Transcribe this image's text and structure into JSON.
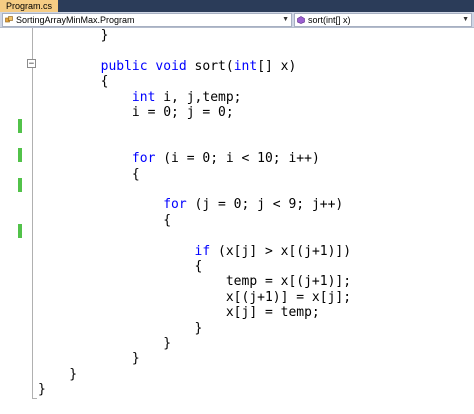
{
  "tab": {
    "title": "Program.cs"
  },
  "navbar": {
    "class_combo": "SortingArrayMinMax.Program",
    "member_combo": "sort(int[] x)"
  },
  "colors": {
    "keyword": "#0000ff",
    "text": "#000000",
    "change_marker": "#52c24a",
    "tab_active": "#f5cc84"
  },
  "code": [
    "        }",
    "",
    "        public void sort(int[] x)",
    "        {",
    "            int i, j,temp;",
    "            i = 0; j = 0;",
    "",
    "",
    "            for (i = 0; i < 10; i++)",
    "            {",
    "",
    "                for (j = 0; j < 9; j++)",
    "                {",
    "",
    "                    if (x[j] > x[(j+1)])",
    "                    {",
    "                        temp = x[(j+1)];",
    "                        x[(j+1)] = x[j];",
    "                        x[j] = temp;",
    "                    }",
    "                }",
    "            }",
    "    }",
    "}"
  ],
  "keywords": [
    "public",
    "void",
    "int",
    "for",
    "if"
  ]
}
